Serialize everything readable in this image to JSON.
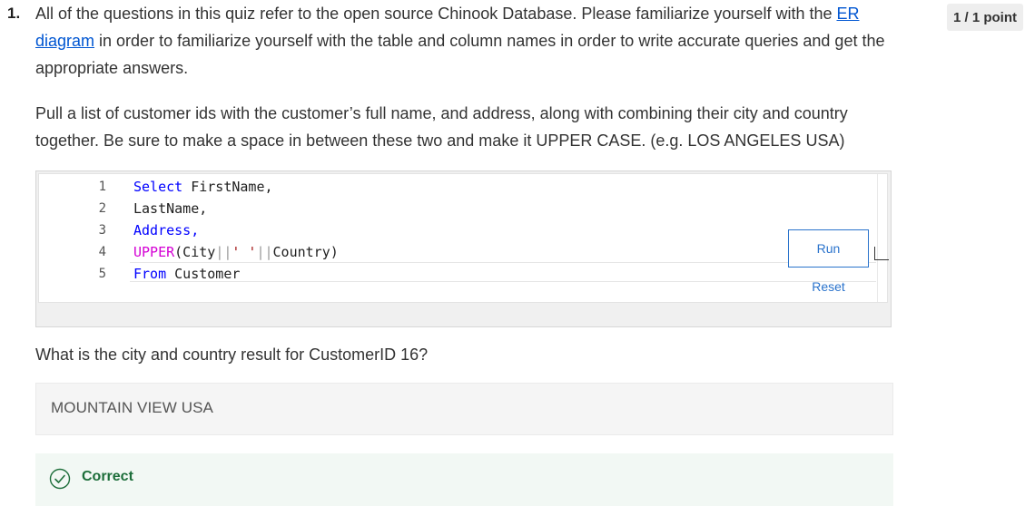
{
  "question": {
    "number": "1.",
    "points": "1 / 1 point",
    "intro_before_link": "All of the questions in this quiz refer to the open source Chinook Database. Please familiarize yourself with the ",
    "link_text": "ER diagram",
    "intro_after_link": " in order to familiarize yourself with the table and column names in order to write accurate queries and get the appropriate answers.",
    "prompt": "Pull a list of customer ids with the customer’s full name, and address, along with combining their city and country together. Be sure to make a space in between these two and make it UPPER CASE. (e.g. LOS ANGELES USA)",
    "ask": "What is the city and country result for CustomerID 16?"
  },
  "editor": {
    "lines": [
      {
        "num": "1",
        "parts": [
          {
            "t": "Select",
            "c": "kw"
          },
          {
            "t": " FirstName,",
            "c": ""
          }
        ]
      },
      {
        "num": "2",
        "parts": [
          {
            "t": "LastName,",
            "c": ""
          }
        ]
      },
      {
        "num": "3",
        "parts": [
          {
            "t": "Address,",
            "c": "kw"
          }
        ]
      },
      {
        "num": "4",
        "parts": [
          {
            "t": "UPPER",
            "c": "fn"
          },
          {
            "t": "(City",
            "c": ""
          },
          {
            "t": "||",
            "c": "pipe"
          },
          {
            "t": "' '",
            "c": "str"
          },
          {
            "t": "||",
            "c": "pipe"
          },
          {
            "t": "Country)",
            "c": ""
          }
        ]
      },
      {
        "num": "5",
        "parts": [
          {
            "t": "From",
            "c": "kw"
          },
          {
            "t": " Customer",
            "c": ""
          }
        ]
      }
    ],
    "run_label": "Run",
    "reset_label": "Reset"
  },
  "answer": {
    "value": "MOUNTAIN VIEW USA"
  },
  "feedback": {
    "status": "Correct",
    "icon": "check-circle-icon",
    "color": "#1d6e3a"
  }
}
